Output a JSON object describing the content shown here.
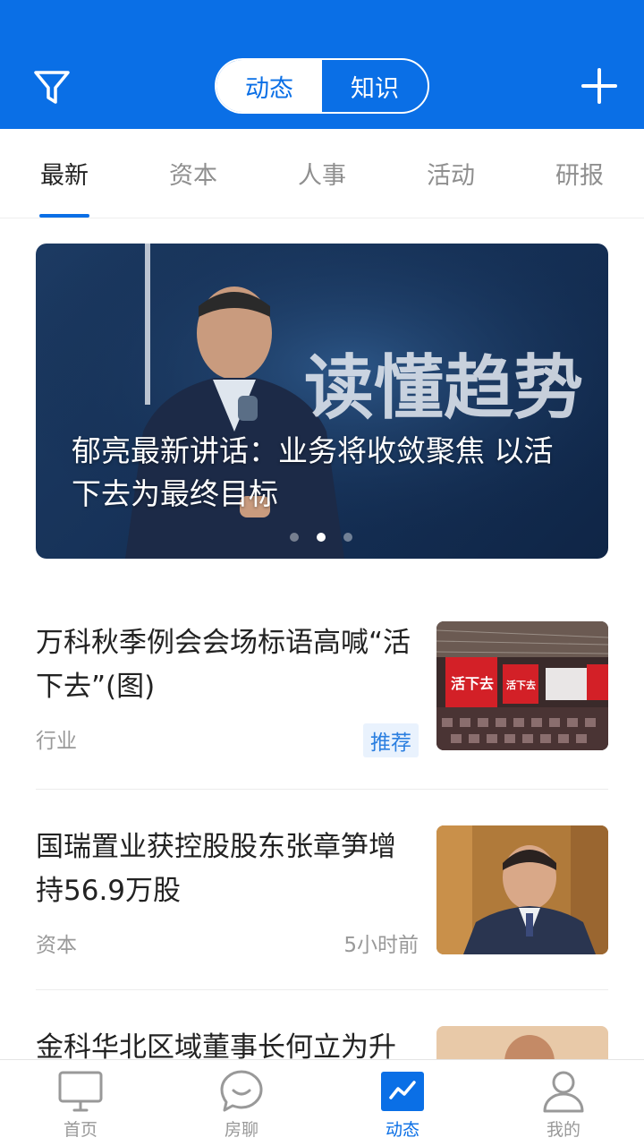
{
  "header": {
    "segments": [
      "动态",
      "知识"
    ],
    "active_segment": "动态",
    "filter_icon": "filter-icon",
    "add_icon": "plus-icon",
    "bg_color": "#0a6fe6"
  },
  "tabs": [
    "最新",
    "资本",
    "人事",
    "活动",
    "研报"
  ],
  "active_tab": "最新",
  "banner": {
    "title": "郁亮最新讲话：业务将收敛聚焦 以活下去为最终目标",
    "image_text": "读懂趋势",
    "slide_count": 3,
    "active_slide": 2
  },
  "news": [
    {
      "title": "万科秋季例会会场标语高喊“活下去”(图)",
      "category": "行业",
      "badge": "推荐",
      "time": "",
      "thumb_text_1": "活下去",
      "thumb_text_2": "活下去"
    },
    {
      "title": "国瑞置业获控股股东张章笋增持56.9万股",
      "category": "资本",
      "badge": "",
      "time": "5小时前"
    },
    {
      "title": "金科华北区域董事长何立为升",
      "category": "",
      "badge": "",
      "time": ""
    }
  ],
  "bottom_nav": [
    {
      "label": "首页",
      "icon": "monitor-icon"
    },
    {
      "label": "房聊",
      "icon": "chat-bubble-icon"
    },
    {
      "label": "动态",
      "icon": "trend-chart-icon"
    },
    {
      "label": "我的",
      "icon": "user-icon"
    }
  ],
  "active_nav": "动态"
}
